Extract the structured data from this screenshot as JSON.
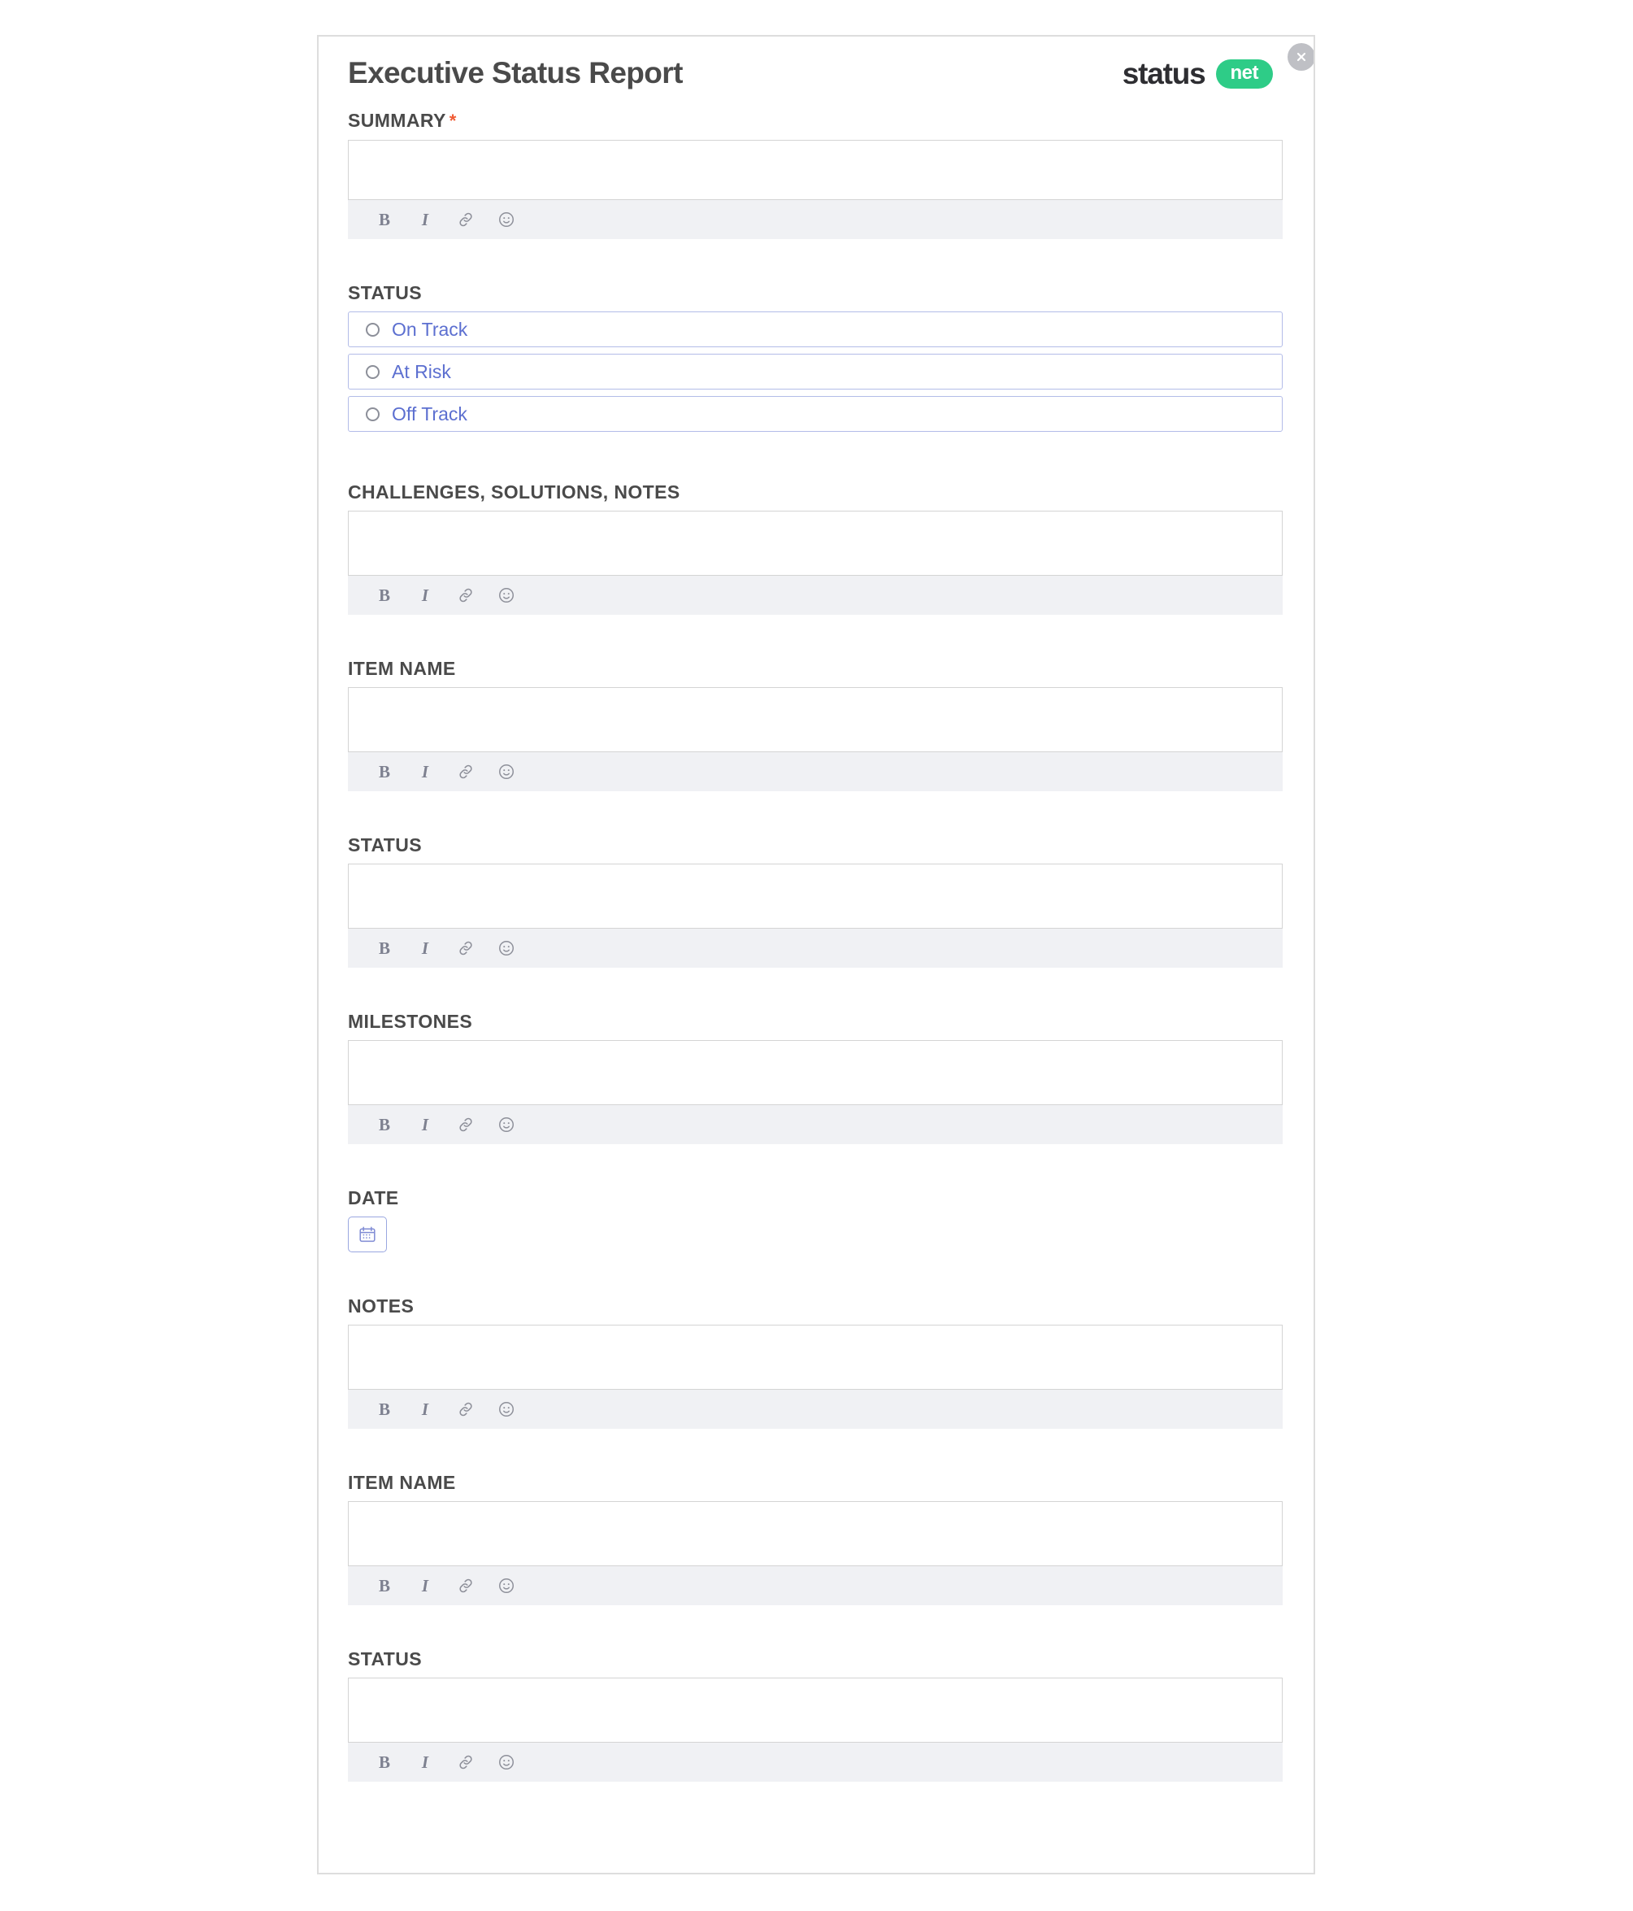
{
  "header": {
    "title": "Executive Status Report",
    "brand_word": "status",
    "brand_pill": "net",
    "close_icon": "close-icon"
  },
  "icons": {
    "bold": "B",
    "italic": "I",
    "link": "link-icon",
    "emoji": "emoji-icon",
    "calendar": "calendar-icon"
  },
  "toolbar": {
    "bold_label": "B",
    "italic_label": "I"
  },
  "fields": [
    {
      "id": "summary",
      "label": "SUMMARY",
      "required": true,
      "type": "richtext",
      "value": "",
      "height": "tall"
    },
    {
      "id": "status-radio",
      "label": "STATUS",
      "required": false,
      "type": "radio",
      "value": ""
    },
    {
      "id": "challenges",
      "label": "CHALLENGES, SOLUTIONS, NOTES",
      "required": false,
      "type": "richtext",
      "value": "",
      "height": "mid"
    },
    {
      "id": "item-name-1",
      "label": "ITEM NAME",
      "required": false,
      "type": "richtext",
      "value": "",
      "height": "mid"
    },
    {
      "id": "status-1",
      "label": "STATUS",
      "required": false,
      "type": "richtext",
      "value": "",
      "height": "mid"
    },
    {
      "id": "milestones",
      "label": "MILESTONES",
      "required": false,
      "type": "richtext",
      "value": "",
      "height": "mid"
    },
    {
      "id": "date",
      "label": "DATE",
      "required": false,
      "type": "date",
      "value": ""
    },
    {
      "id": "notes",
      "label": "NOTES",
      "required": false,
      "type": "richtext",
      "value": "",
      "height": "mid"
    },
    {
      "id": "item-name-2",
      "label": "ITEM NAME",
      "required": false,
      "type": "richtext",
      "value": "",
      "height": "mid"
    },
    {
      "id": "status-2",
      "label": "STATUS",
      "required": false,
      "type": "richtext-cut",
      "value": "",
      "height": "mid"
    }
  ],
  "status_options": [
    {
      "label": "On Track",
      "selected": false
    },
    {
      "label": "At Risk",
      "selected": false
    },
    {
      "label": "Off Track",
      "selected": false
    }
  ],
  "colors": {
    "accent_green": "#2ecc87",
    "required_orange": "#f05b34",
    "radio_blue": "#5c6fd0",
    "radio_border": "#b3bce8",
    "label_gray": "#4a4a4a",
    "toolbar_bg": "#f0f1f4"
  }
}
